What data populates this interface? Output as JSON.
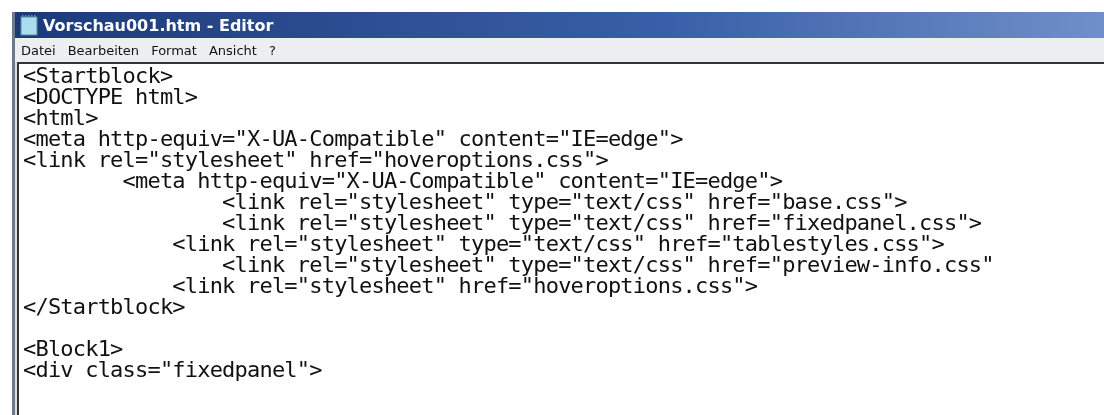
{
  "window": {
    "title": "Vorschau001.htm - Editor"
  },
  "menu": [
    {
      "label": "Datei"
    },
    {
      "label": "Bearbeiten"
    },
    {
      "label": "Format"
    },
    {
      "label": "Ansicht"
    },
    {
      "label": "?"
    }
  ],
  "editor": {
    "blocks": [
      [
        "<Startblock>",
        "<DOCTYPE html>",
        "<html>",
        "<meta http-equiv=\"X-UA-Compatible\" content=\"IE=edge\">",
        "<link rel=\"stylesheet\" href=\"hoveroptions.css\">",
        "        <meta http-equiv=\"X-UA-Compatible\" content=\"IE=edge\">",
        "                <link rel=\"stylesheet\" type=\"text/css\" href=\"base.css\">",
        "                <link rel=\"stylesheet\" type=\"text/css\" href=\"fixedpanel.css\">",
        "            <link rel=\"stylesheet\" type=\"text/css\" href=\"tablestyles.css\">",
        "                <link rel=\"stylesheet\" type=\"text/css\" href=\"preview-info.css\"",
        "            <link rel=\"stylesheet\" href=\"hoveroptions.css\">",
        "</Startblock>"
      ],
      [
        "<Block1>",
        "<div class=\"fixedpanel\">"
      ]
    ]
  }
}
